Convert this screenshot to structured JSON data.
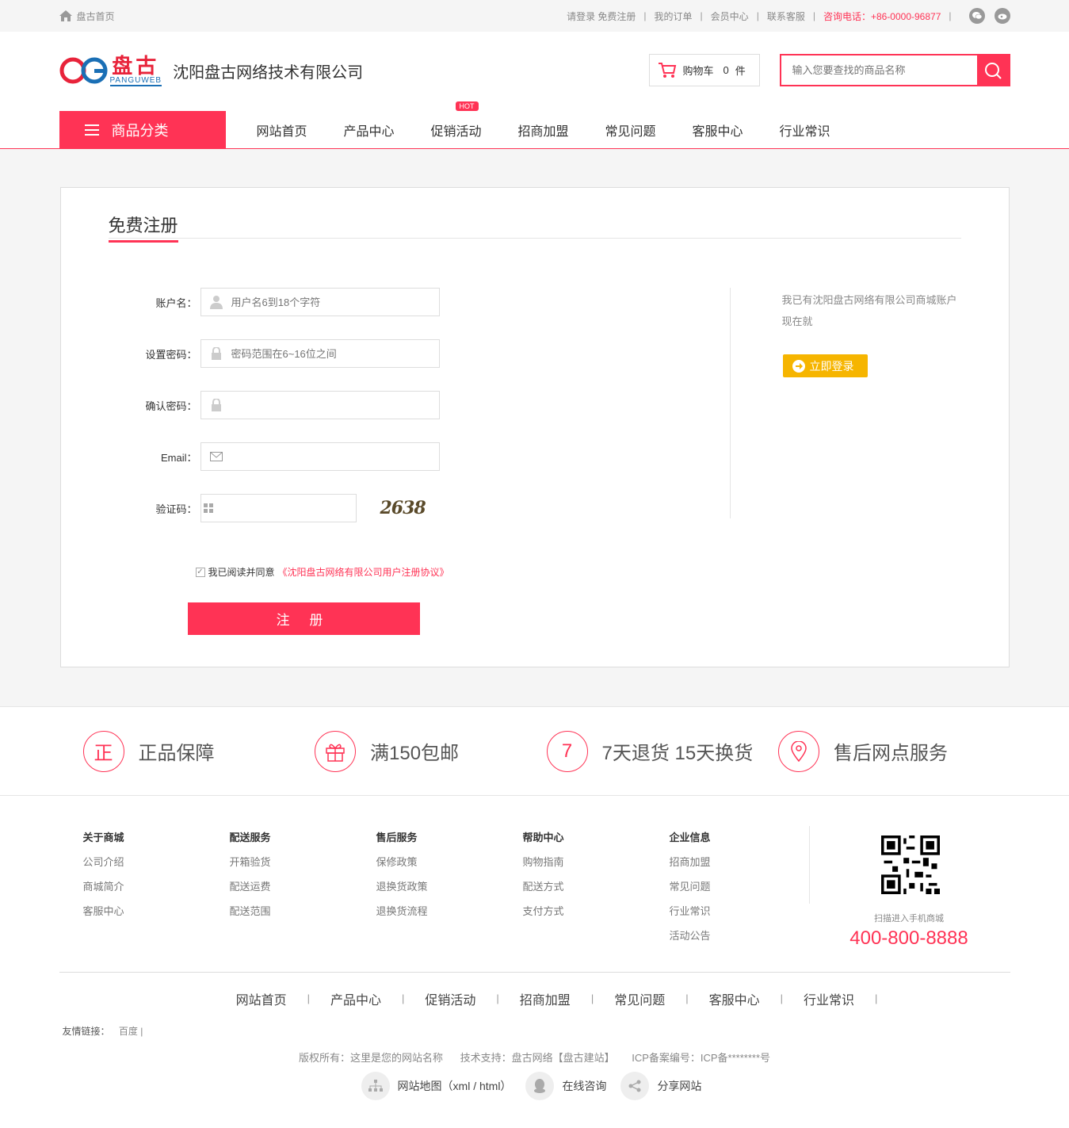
{
  "topbar": {
    "home": "盘古首页",
    "links": [
      "请登录 免费注册",
      "我的订单",
      "会员中心",
      "联系客服"
    ],
    "hotline": "咨询电话：+86-0000-96877"
  },
  "header": {
    "logo_cn": "盘古",
    "logo_en": "PANGUWEB",
    "company": "沈阳盘古网络技术有限公司",
    "cart_label": "购物车",
    "cart_count": "0",
    "cart_unit": "件",
    "search_placeholder": "输入您要查找的商品名称"
  },
  "nav": {
    "category": "商品分类",
    "items": [
      "网站首页",
      "产品中心",
      "促销活动",
      "招商加盟",
      "常见问题",
      "客服中心",
      "行业常识"
    ],
    "hot_badge": "HOT"
  },
  "register": {
    "title": "免费注册",
    "fields": {
      "username_label": "账户名：",
      "username_placeholder": "用户名6到18个字符",
      "password_label": "设置密码：",
      "password_placeholder": "密码范围在6~16位之间",
      "confirm_label": "确认密码：",
      "email_label": "Email：",
      "captcha_label": "验证码：",
      "captcha_text": "2638"
    },
    "agree_text": "我已阅读并同意",
    "agree_link": "《沈阳盘古网络有限公司用户注册协议》",
    "submit": "注 册",
    "side_text": "我已有沈阳盘古网络有限公司商城账户现在就",
    "login_button": "立即登录"
  },
  "services": [
    {
      "icon": "正",
      "text": "正品保障"
    },
    {
      "icon": "gift-icon",
      "text": "满150包邮"
    },
    {
      "icon": "7",
      "text": "7天退货 15天换货"
    },
    {
      "icon": "location-icon",
      "text": "售后网点服务"
    }
  ],
  "footer": {
    "columns": [
      {
        "title": "关于商城",
        "items": [
          "公司介绍",
          "商城简介",
          "客服中心"
        ]
      },
      {
        "title": "配送服务",
        "items": [
          "开箱验货",
          "配送运费",
          "配送范围"
        ]
      },
      {
        "title": "售后服务",
        "items": [
          "保修政策",
          "退换货政策",
          "退换货流程"
        ]
      },
      {
        "title": "帮助中心",
        "items": [
          "购物指南",
          "配送方式",
          "支付方式"
        ]
      },
      {
        "title": "企业信息",
        "items": [
          "招商加盟",
          "常见问题",
          "行业常识",
          "活动公告"
        ]
      }
    ],
    "qr_text": "扫描进入手机商城",
    "phone": "400-800-8888",
    "nav": [
      "网站首页",
      "产品中心",
      "促销活动",
      "招商加盟",
      "常见问题",
      "客服中心",
      "行业常识"
    ],
    "friend_label": "友情链接：",
    "friend_link": "百度 |",
    "copyright": [
      "版权所有：这里是您的网站名称",
      "技术支持：盘古网络【盘古建站】",
      "ICP备案编号：ICP备********号"
    ],
    "bottom_links": [
      "网站地图（xml / html）",
      "在线咨询",
      "分享网站"
    ]
  },
  "colors": {
    "accent": "#ff3355",
    "login": "#f6b500",
    "logo_blue": "#1a6fb5",
    "logo_red": "#e8233a"
  }
}
